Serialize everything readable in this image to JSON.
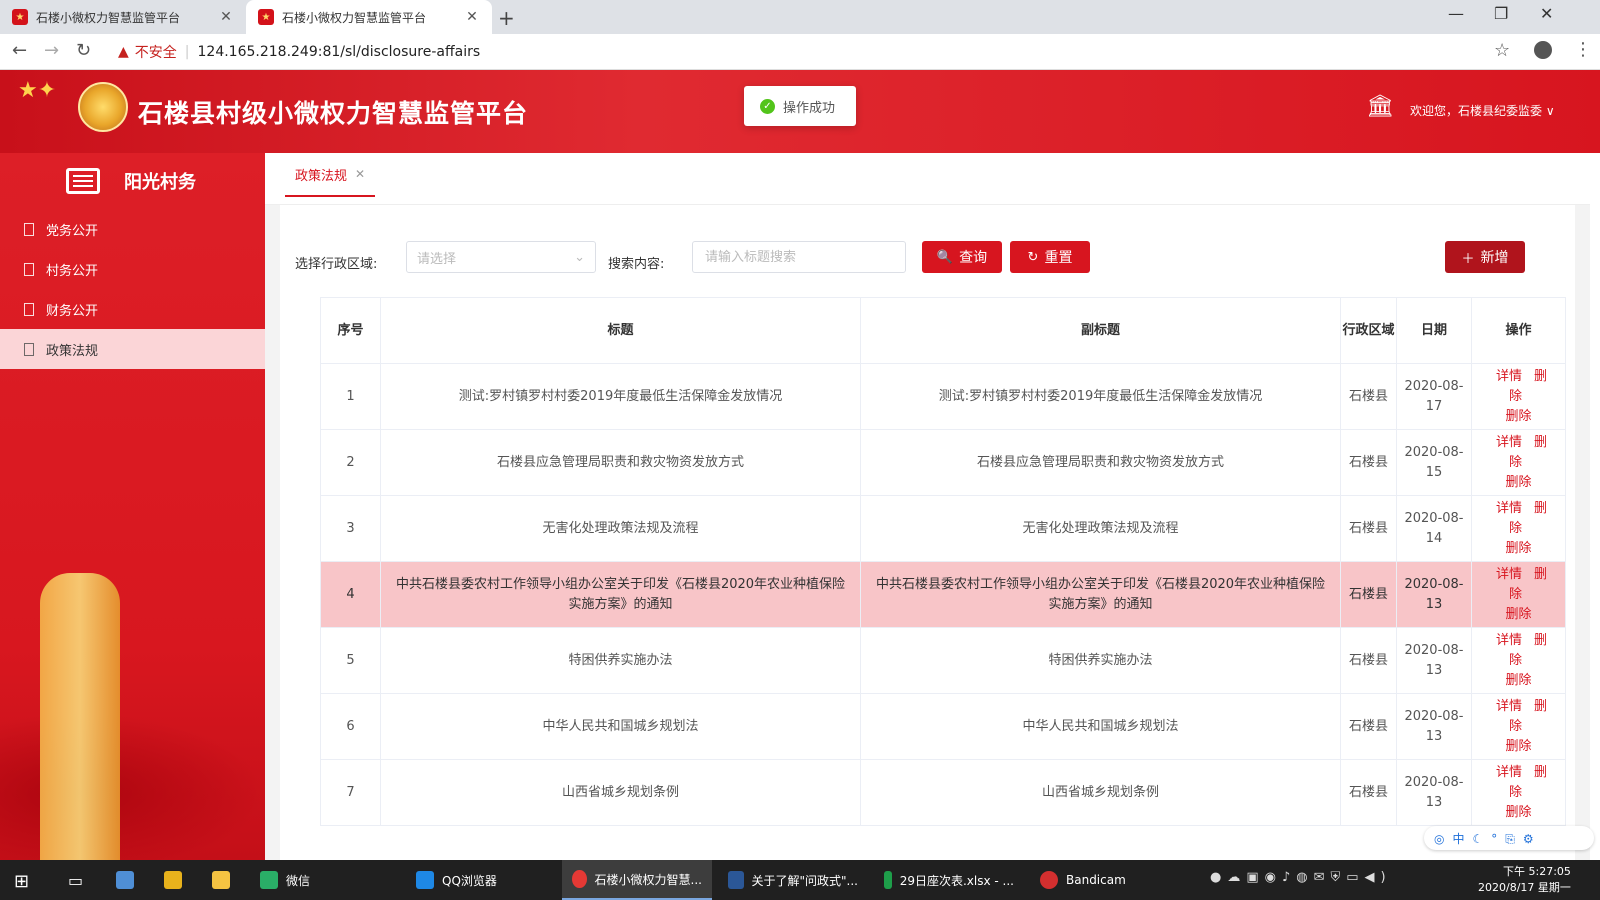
{
  "browser": {
    "tabs": [
      {
        "title": "石楼小微权力智慧监管平台",
        "active": false
      },
      {
        "title": "石楼小微权力智慧监管平台",
        "active": true
      }
    ],
    "insecure_label": "不安全",
    "url": "124.165.218.249:81/sl/disclosure-affairs"
  },
  "header": {
    "title": "石楼县村级小微权力智慧监管平台",
    "toast": "操作成功",
    "welcome": "欢迎您，石楼县纪委监委 ∨"
  },
  "sidebar": {
    "title": "阳光村务",
    "items": [
      {
        "label": "党务公开",
        "active": false
      },
      {
        "label": "村务公开",
        "active": false
      },
      {
        "label": "财务公开",
        "active": false
      },
      {
        "label": "政策法规",
        "active": true
      }
    ]
  },
  "main": {
    "page_tab": "政策法规",
    "filters": {
      "region_label": "选择行政区域:",
      "region_placeholder": "请选择",
      "search_label": "搜索内容:",
      "search_placeholder": "请输入标题搜索"
    },
    "buttons": {
      "query": "查询",
      "reset": "重置",
      "add": "新增"
    },
    "table": {
      "columns": [
        "序号",
        "标题",
        "副标题",
        "行政区域",
        "日期",
        "操作"
      ],
      "ops": {
        "detail": "详情",
        "delete1": "删除",
        "delete2": "删除"
      },
      "rows": [
        {
          "no": "1",
          "title": "测试:罗村镇罗村村委2019年度最低生活保障金发放情况",
          "subtitle": "测试:罗村镇罗村村委2019年度最低生活保障金发放情况",
          "region": "石楼县",
          "date": "2020-08-17",
          "highlight": false
        },
        {
          "no": "2",
          "title": "石楼县应急管理局职责和救灾物资发放方式",
          "subtitle": "石楼县应急管理局职责和救灾物资发放方式",
          "region": "石楼县",
          "date": "2020-08-15",
          "highlight": false
        },
        {
          "no": "3",
          "title": "无害化处理政策法规及流程",
          "subtitle": "无害化处理政策法规及流程",
          "region": "石楼县",
          "date": "2020-08-14",
          "highlight": false
        },
        {
          "no": "4",
          "title": "中共石楼县委农村工作领导小组办公室关于印发《石楼县2020年农业种植保险实施方案》的通知",
          "subtitle": "中共石楼县委农村工作领导小组办公室关于印发《石楼县2020年农业种植保险实施方案》的通知",
          "region": "石楼县",
          "date": "2020-08-13",
          "highlight": true
        },
        {
          "no": "5",
          "title": "特困供养实施办法",
          "subtitle": "特困供养实施办法",
          "region": "石楼县",
          "date": "2020-08-13",
          "highlight": false
        },
        {
          "no": "6",
          "title": "中华人民共和国城乡规划法",
          "subtitle": "中华人民共和国城乡规划法",
          "region": "石楼县",
          "date": "2020-08-13",
          "highlight": false
        },
        {
          "no": "7",
          "title": "山西省城乡规划条例",
          "subtitle": "山西省城乡规划条例",
          "region": "石楼县",
          "date": "2020-08-13",
          "highlight": false
        }
      ]
    }
  },
  "taskbar": {
    "items": [
      {
        "label": "微信",
        "color": "#2aae67"
      },
      {
        "label": "QQ浏览器",
        "color": "#1e88e5"
      },
      {
        "label": "石楼小微权力智慧...",
        "color": "#e53935"
      },
      {
        "label": "关于了解\"问政式\"...",
        "color": "#2b5797"
      },
      {
        "label": "29日座次表.xlsx - ...",
        "color": "#1e9e4a"
      },
      {
        "label": "Bandicam",
        "color": "#d32f2f"
      }
    ],
    "time": "下午 5:27:05",
    "date": "2020/8/17 星期一"
  },
  "colors": {
    "brand": "#d7151f",
    "highlight_row": "#f8c5c8",
    "sidebar_active": "#fbd5d7"
  }
}
